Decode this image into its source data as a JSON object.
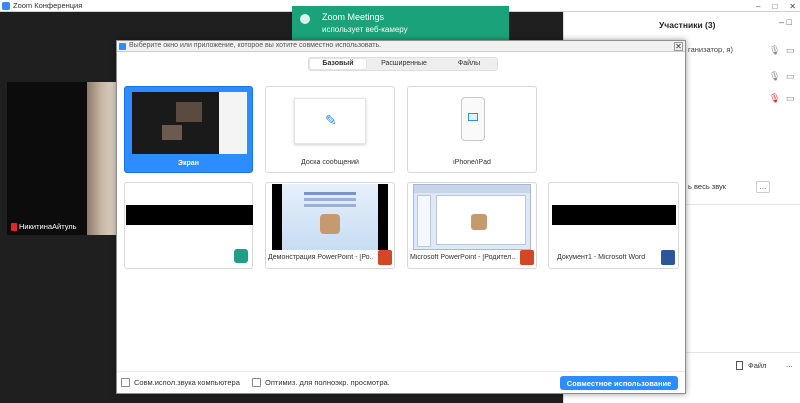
{
  "window": {
    "title": "Zoom Конференция",
    "controls": [
      "–",
      "□",
      "✕"
    ]
  },
  "participant": {
    "name": "НикитинаАйтуль"
  },
  "notification": {
    "title": "Zoom Meetings",
    "subtitle": "использует веб-камеру"
  },
  "participants_panel": {
    "title": "Участники (3)",
    "host_role": "ганизатор, я)",
    "mute_all_label": "ь весь звук",
    "more_label": "...",
    "file_label": "Файл",
    "panel_controls": "– □"
  },
  "share_dialog": {
    "header_text": "Выберите окно или приложение, которое вы хотите совместно использовать.",
    "tabs": [
      {
        "label": "Базовый",
        "selected": true
      },
      {
        "label": "Расширенные",
        "selected": false
      },
      {
        "label": "Файлы",
        "selected": false
      }
    ],
    "tiles": [
      {
        "label": "Экран",
        "selected": true
      },
      {
        "label": "Доска сообщений",
        "selected": false
      },
      {
        "label": "iPhone/iPad",
        "selected": false
      },
      {
        "label": "",
        "selected": false
      },
      {
        "label": "Демонстрация PowerPoint - [Ро...",
        "selected": false
      },
      {
        "label": "Microsoft PowerPoint - [Родител...",
        "selected": false
      },
      {
        "label": "Документ1 - Microsoft Word",
        "selected": false
      }
    ],
    "footer": {
      "share_audio_label": "Совм.испол.звука компьютера",
      "optimize_label": "Оптимиз. для полноэкр. просмотра.",
      "share_button": "Совместное использование"
    }
  },
  "colors": {
    "accent": "#2d8cff",
    "notification": "#1aa37a",
    "muted": "#e02828",
    "powerpoint": "#d24726",
    "word": "#2b5797"
  }
}
